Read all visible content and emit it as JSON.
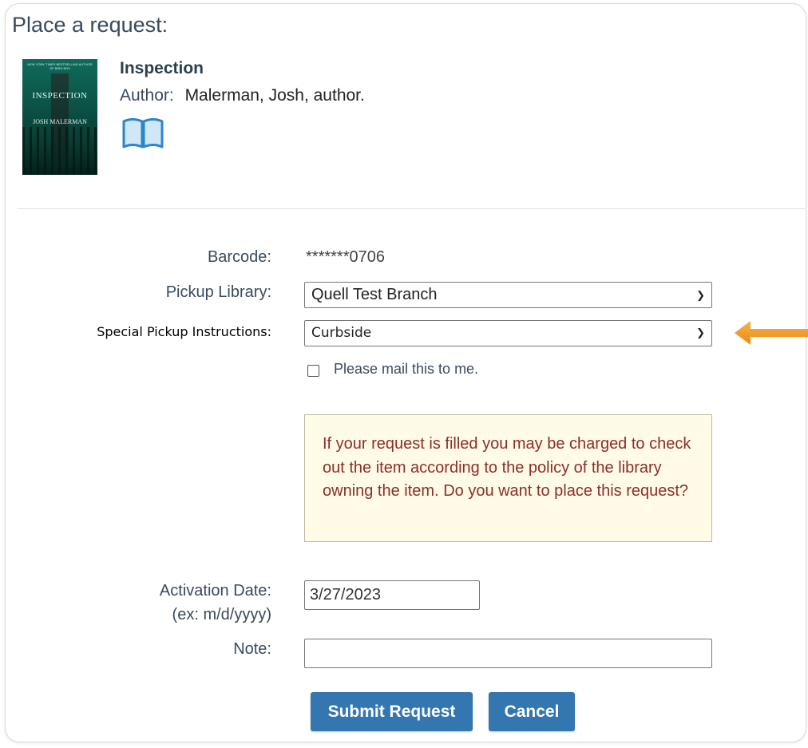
{
  "page": {
    "heading": "Place a request:"
  },
  "item": {
    "title": "Inspection",
    "author_label": "Author:",
    "author": "Malerman, Josh, author.",
    "cover": {
      "top_text": "NEW YORK TIMES BESTSELLING AUTHOR OF BIRD BOX",
      "title": "INSPECTION",
      "author": "JOSH MALERMAN"
    },
    "format_icon": "book-icon"
  },
  "form": {
    "barcode_label": "Barcode:",
    "barcode_value": "*******0706",
    "pickup_label": "Pickup Library:",
    "pickup_value": "Quell Test Branch",
    "special_label": "Special Pickup Instructions:",
    "special_value": "Curbside",
    "mail_label": "Please mail this to me.",
    "mail_checked": false,
    "notice": "If your request is filled you may be charged to check out the item according to the policy of the library owning the item. Do you want to place this request?",
    "activation_label": "Activation Date:",
    "activation_hint": "(ex: m/d/yyyy)",
    "activation_value": "3/27/2023",
    "note_label": "Note:",
    "note_value": ""
  },
  "buttons": {
    "submit": "Submit Request",
    "cancel": "Cancel"
  },
  "colors": {
    "button": "#3476b0",
    "notice_bg": "#fffbe6",
    "notice_text": "#8b2d2d",
    "arrow": "#f39c1f"
  }
}
